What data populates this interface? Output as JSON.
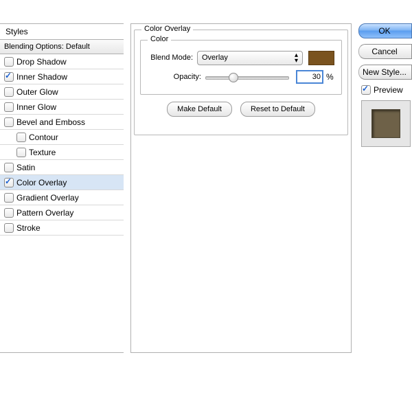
{
  "colors": {
    "overlay_swatch": "#7a531f",
    "preview_inner": "#6e6148"
  },
  "styles_panel": {
    "heading": "Styles",
    "blending_options": "Blending Options: Default",
    "items": [
      {
        "label": "Drop Shadow",
        "checked": false,
        "selected": false,
        "indent": false
      },
      {
        "label": "Inner Shadow",
        "checked": true,
        "selected": false,
        "indent": false
      },
      {
        "label": "Outer Glow",
        "checked": false,
        "selected": false,
        "indent": false
      },
      {
        "label": "Inner Glow",
        "checked": false,
        "selected": false,
        "indent": false
      },
      {
        "label": "Bevel and Emboss",
        "checked": false,
        "selected": false,
        "indent": false
      },
      {
        "label": "Contour",
        "checked": false,
        "selected": false,
        "indent": true
      },
      {
        "label": "Texture",
        "checked": false,
        "selected": false,
        "indent": true
      },
      {
        "label": "Satin",
        "checked": false,
        "selected": false,
        "indent": false
      },
      {
        "label": "Color Overlay",
        "checked": true,
        "selected": true,
        "indent": false
      },
      {
        "label": "Gradient Overlay",
        "checked": false,
        "selected": false,
        "indent": false
      },
      {
        "label": "Pattern Overlay",
        "checked": false,
        "selected": false,
        "indent": false
      },
      {
        "label": "Stroke",
        "checked": false,
        "selected": false,
        "indent": false
      }
    ]
  },
  "overlay_panel": {
    "group_title": "Color Overlay",
    "color_group_title": "Color",
    "blend_mode_label": "Blend Mode:",
    "blend_mode_value": "Overlay",
    "opacity_label": "Opacity:",
    "opacity_value": "30",
    "opacity_suffix": "%",
    "make_default": "Make Default",
    "reset_default": "Reset to Default"
  },
  "right": {
    "ok": "OK",
    "cancel": "Cancel",
    "new_style": "New Style...",
    "preview_label": "Preview",
    "preview_checked": true
  }
}
